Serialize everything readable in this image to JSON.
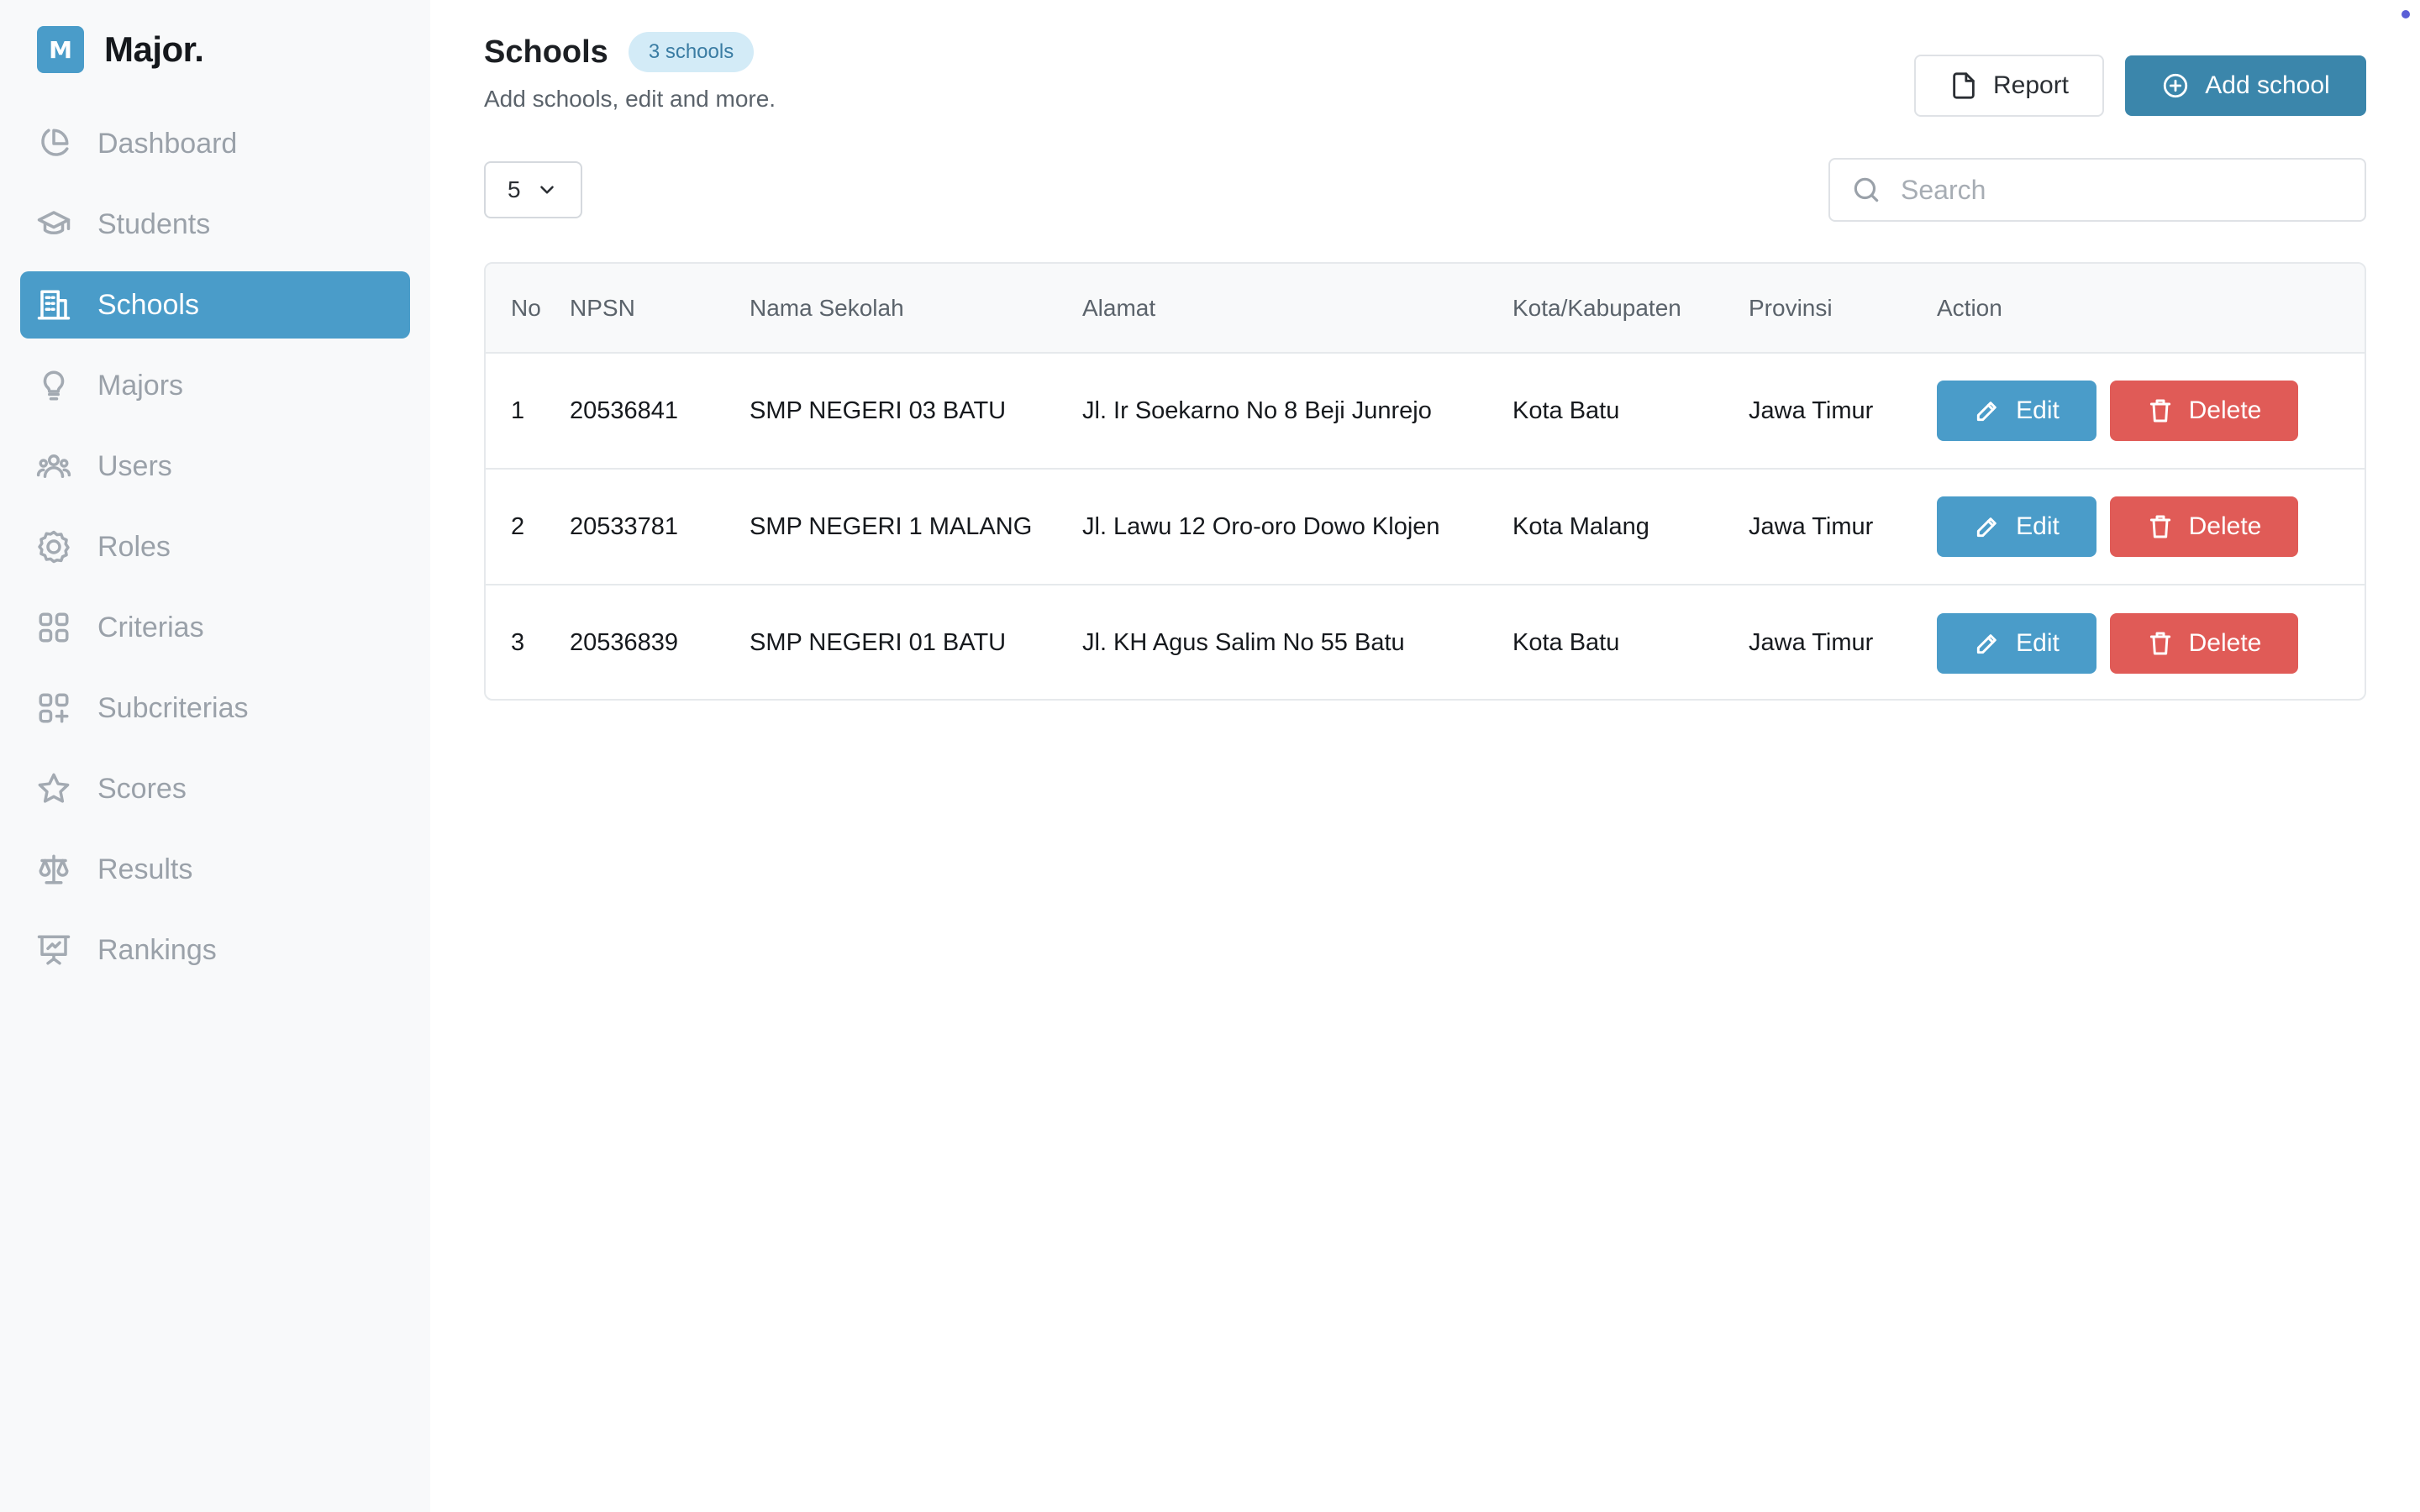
{
  "brand": {
    "logo_letter": "M",
    "name": "Major."
  },
  "sidebar": {
    "items": [
      {
        "label": "Dashboard",
        "icon": "pie-chart-icon",
        "active": false
      },
      {
        "label": "Students",
        "icon": "graduation-cap-icon",
        "active": false
      },
      {
        "label": "Schools",
        "icon": "building-icon",
        "active": true
      },
      {
        "label": "Majors",
        "icon": "lightbulb-icon",
        "active": false
      },
      {
        "label": "Users",
        "icon": "users-icon",
        "active": false
      },
      {
        "label": "Roles",
        "icon": "badge-icon",
        "active": false
      },
      {
        "label": "Criterias",
        "icon": "grid-icon",
        "active": false
      },
      {
        "label": "Subcriterias",
        "icon": "grid-plus-icon",
        "active": false
      },
      {
        "label": "Scores",
        "icon": "star-icon",
        "active": false
      },
      {
        "label": "Results",
        "icon": "scale-icon",
        "active": false
      },
      {
        "label": "Rankings",
        "icon": "presentation-icon",
        "active": false
      }
    ]
  },
  "header": {
    "title": "Schools",
    "badge": "3 schools",
    "subtitle": "Add schools, edit and more.",
    "report_label": "Report",
    "add_label": "Add school"
  },
  "controls": {
    "per_page": "5",
    "search_placeholder": "Search",
    "search_value": ""
  },
  "table": {
    "columns": [
      "No",
      "NPSN",
      "Nama Sekolah",
      "Alamat",
      "Kota/Kabupaten",
      "Provinsi",
      "Action"
    ],
    "rows": [
      {
        "no": "1",
        "npsn": "20536841",
        "nama": "SMP NEGERI 03 BATU",
        "alamat": "Jl. Ir Soekarno No 8 Beji Junrejo",
        "kota": "Kota Batu",
        "provinsi": "Jawa Timur"
      },
      {
        "no": "2",
        "npsn": "20533781",
        "nama": "SMP NEGERI 1 MALANG",
        "alamat": "Jl. Lawu 12 Oro-oro Dowo Klojen",
        "kota": "Kota Malang",
        "provinsi": "Jawa Timur"
      },
      {
        "no": "3",
        "npsn": "20536839",
        "nama": "SMP NEGERI 01 BATU",
        "alamat": "Jl. KH Agus Salim No 55 Batu",
        "kota": "Kota Batu",
        "provinsi": "Jawa Timur"
      }
    ],
    "edit_label": "Edit",
    "delete_label": "Delete"
  },
  "colors": {
    "accent": "#4a9cc9",
    "primary_button": "#3b86ab",
    "danger": "#e05b57",
    "badge_bg": "#d3ebf7"
  }
}
